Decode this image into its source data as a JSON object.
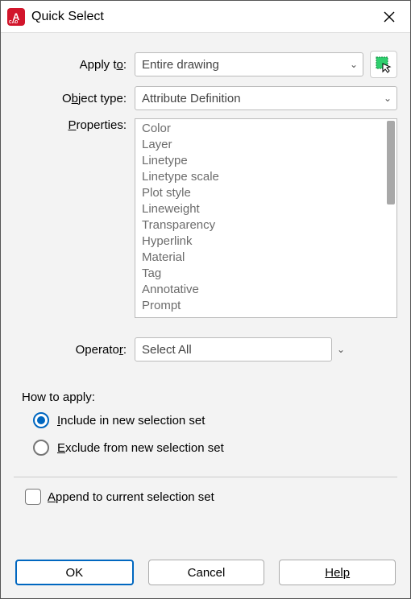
{
  "window": {
    "title": "Quick Select"
  },
  "fields": {
    "apply_to": {
      "label": "Apply to:",
      "accel": "o",
      "value": "Entire drawing"
    },
    "object_type": {
      "label": "Object type:",
      "accel": "b",
      "value": "Attribute Definition"
    },
    "properties": {
      "label": "Properties:",
      "accel": "P"
    },
    "operator": {
      "label": "Operator:",
      "accel": "r",
      "value": "Select All"
    }
  },
  "properties_list": [
    "Color",
    "Layer",
    "Linetype",
    "Linetype scale",
    "Plot style",
    "Lineweight",
    "Transparency",
    "Hyperlink",
    "Material",
    "Tag",
    "Annotative",
    "Prompt"
  ],
  "how_apply": {
    "label": "How to apply:",
    "include": "Include in new selection set",
    "exclude": "Exclude from new selection set",
    "selected": "include"
  },
  "append": {
    "label": "Append to current selection set",
    "checked": false
  },
  "buttons": {
    "ok": "OK",
    "cancel": "Cancel",
    "help": "Help"
  }
}
